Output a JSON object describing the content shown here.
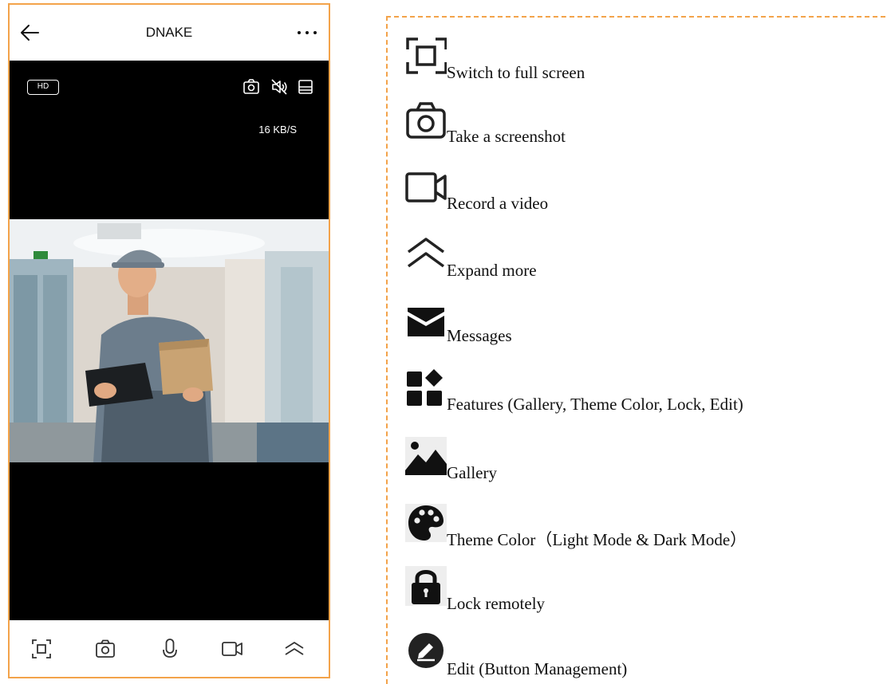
{
  "app": {
    "title": "DNAKE",
    "hd_label": "HD",
    "speed": "16 KB/S"
  },
  "legend": {
    "items": [
      {
        "icon": "fullscreen-icon",
        "label": "Switch to full screen"
      },
      {
        "icon": "camera-icon",
        "label": "Take a screenshot"
      },
      {
        "icon": "video-camera-icon",
        "label": "Record a video"
      },
      {
        "icon": "chevron-up-double-icon",
        "label": "Expand more"
      },
      {
        "icon": "envelope-icon",
        "label": "Messages"
      },
      {
        "icon": "features-grid-icon",
        "label": "Features (Gallery, Theme Color, Lock, Edit)"
      },
      {
        "icon": "gallery-icon",
        "label": "Gallery"
      },
      {
        "icon": "palette-icon",
        "label": "Theme Color（Light Mode & Dark Mode）"
      },
      {
        "icon": "lock-icon",
        "label": "Lock remotely"
      },
      {
        "icon": "edit-icon",
        "label": "Edit (Button Management)"
      }
    ]
  },
  "colors": {
    "frame_border": "#f3a34a",
    "video_bg": "#000000"
  }
}
